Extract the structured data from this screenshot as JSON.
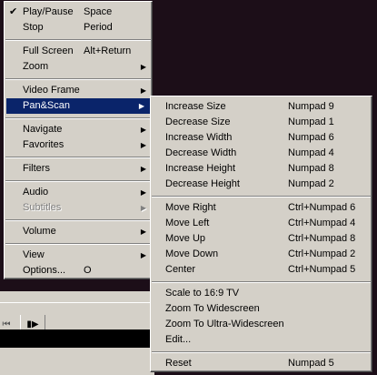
{
  "main_menu": {
    "items": [
      {
        "label": "Play/Pause",
        "shortcut": "Space",
        "check": "✔"
      },
      {
        "label": "Stop",
        "shortcut": "Period"
      },
      {
        "separator": true
      },
      {
        "label": "Full Screen",
        "shortcut": "Alt+Return"
      },
      {
        "label": "Zoom",
        "submenu": true
      },
      {
        "separator": true
      },
      {
        "label": "Video Frame",
        "submenu": true
      },
      {
        "label": "Pan&Scan",
        "submenu": true,
        "selected": true
      },
      {
        "separator": true
      },
      {
        "label": "Navigate",
        "submenu": true
      },
      {
        "label": "Favorites",
        "submenu": true
      },
      {
        "separator": true
      },
      {
        "label": "Filters",
        "submenu": true
      },
      {
        "separator": true
      },
      {
        "label": "Audio",
        "submenu": true
      },
      {
        "label": "Subtitles",
        "submenu": true,
        "disabled": true
      },
      {
        "separator": true
      },
      {
        "label": "Volume",
        "submenu": true
      },
      {
        "separator": true
      },
      {
        "label": "View",
        "submenu": true
      },
      {
        "label": "Options...",
        "shortcut": "O"
      }
    ]
  },
  "sub_menu": {
    "items": [
      {
        "label": "Increase Size",
        "shortcut": "Numpad 9"
      },
      {
        "label": "Decrease Size",
        "shortcut": "Numpad 1"
      },
      {
        "label": "Increase Width",
        "shortcut": "Numpad 6"
      },
      {
        "label": "Decrease Width",
        "shortcut": "Numpad 4"
      },
      {
        "label": "Increase Height",
        "shortcut": "Numpad 8"
      },
      {
        "label": "Decrease Height",
        "shortcut": "Numpad 2"
      },
      {
        "separator": true
      },
      {
        "label": "Move Right",
        "shortcut": "Ctrl+Numpad 6"
      },
      {
        "label": "Move Left",
        "shortcut": "Ctrl+Numpad 4"
      },
      {
        "label": "Move Up",
        "shortcut": "Ctrl+Numpad 8"
      },
      {
        "label": "Move Down",
        "shortcut": "Ctrl+Numpad 2"
      },
      {
        "label": "Center",
        "shortcut": "Ctrl+Numpad 5"
      },
      {
        "separator": true
      },
      {
        "label": "Scale to 16:9 TV"
      },
      {
        "label": "Zoom To Widescreen"
      },
      {
        "label": "Zoom To Ultra-Widescreen"
      },
      {
        "label": "Edit..."
      },
      {
        "separator": true
      },
      {
        "label": "Reset",
        "shortcut": "Numpad 5"
      }
    ]
  },
  "player": {
    "prev_glyph": "⏮",
    "step_glyph": "▮▶"
  },
  "colors": {
    "menu_bg": "#d4d0c8",
    "highlight": "#0a246a",
    "video_bg": "#1c0e18"
  },
  "icons": {
    "arrow": "▶"
  }
}
